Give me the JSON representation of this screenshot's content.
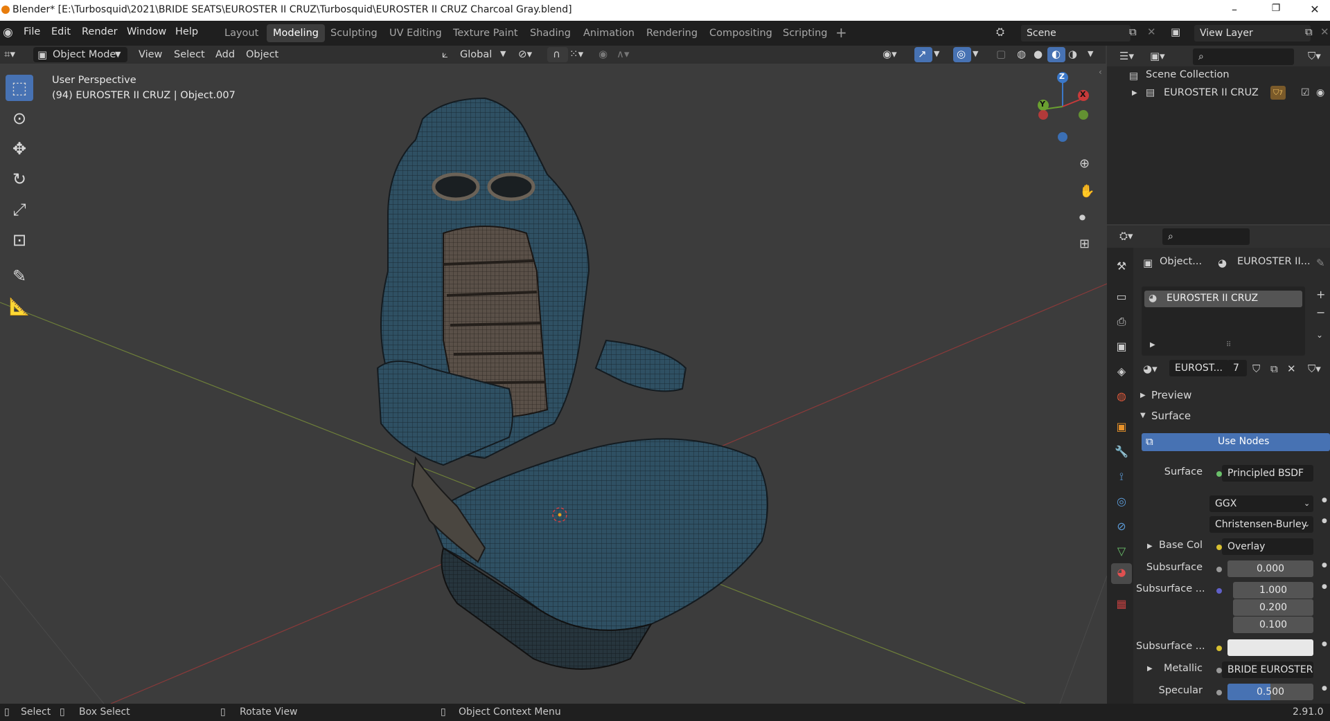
{
  "window": {
    "title": "Blender* [E:\\Turbosquid\\2021\\BRIDE SEATS\\EUROSTER II CRUZ\\Turbosquid\\EUROSTER II CRUZ Charcoal Gray.blend]",
    "controls": [
      "–",
      "❐",
      "✕"
    ]
  },
  "menu": [
    "File",
    "Edit",
    "Render",
    "Window",
    "Help"
  ],
  "workspaces": [
    {
      "label": "Layout",
      "active": false
    },
    {
      "label": "Modeling",
      "active": true
    },
    {
      "label": "Sculpting",
      "active": false
    },
    {
      "label": "UV Editing",
      "active": false
    },
    {
      "label": "Texture Paint",
      "active": false
    },
    {
      "label": "Shading",
      "active": false
    },
    {
      "label": "Animation",
      "active": false
    },
    {
      "label": "Rendering",
      "active": false
    },
    {
      "label": "Compositing",
      "active": false
    },
    {
      "label": "Scripting",
      "active": false
    }
  ],
  "add_workspace": "+",
  "scene": {
    "name": "Scene",
    "view_layer": "View Layer"
  },
  "viewport_header": {
    "mode": "Object Mode",
    "menus": [
      "View",
      "Select",
      "Add",
      "Object"
    ],
    "orientation": "Global"
  },
  "viewport": {
    "perspective": "User Perspective",
    "object_info": "(94) EUROSTER II CRUZ | Object.007",
    "gizmo_axes": [
      "Z",
      "Y",
      "X"
    ]
  },
  "outliner": {
    "collection": "Scene Collection",
    "items": [
      {
        "label": "EUROSTER II CRUZ",
        "badge": "7"
      }
    ]
  },
  "properties": {
    "breadcrumb": [
      "Object...",
      "EUROSTER II..."
    ],
    "material_slot": "EUROSTER II CRUZ",
    "material_name": "EUROST...",
    "user_count": "7",
    "sections": {
      "preview": "Preview",
      "surface": "Surface"
    },
    "use_nodes": "Use Nodes",
    "surface_label": "Surface",
    "surface_value": "Principled BSDF",
    "distribution": "GGX",
    "subsurface_method": "Christensen-Burley",
    "rows": [
      {
        "label": "Base Col",
        "value": "Overlay",
        "kind": "link"
      },
      {
        "label": "Subsurface",
        "value": "0.000",
        "kind": "num"
      },
      {
        "label": "Subsurface ...",
        "values": [
          "1.000",
          "0.200",
          "0.100"
        ],
        "kind": "vec"
      },
      {
        "label": "Subsurface ...",
        "value": "",
        "kind": "color"
      },
      {
        "label": "Metallic",
        "value": "BRIDE EUROSTER...",
        "kind": "link"
      },
      {
        "label": "Specular",
        "value": "0.500",
        "kind": "slider",
        "fill": 0.5
      }
    ]
  },
  "statusbar": {
    "select": "Select",
    "box_select": "Box Select",
    "rotate": "Rotate View",
    "context": "Object Context Menu",
    "version": "2.91.0"
  },
  "colors": {
    "accent": "#4772b3",
    "seat_blue": "#2f4f63",
    "seat_dark": "#1f2a31",
    "grid_x": "#8a3a3a",
    "grid_y": "#6e7f3a"
  }
}
